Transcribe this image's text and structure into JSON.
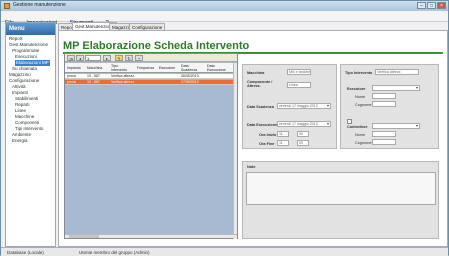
{
  "window": {
    "title": "Gestione manutenzione"
  },
  "menu": [
    "File",
    "Impostazioni",
    "Strumenti",
    "?"
  ],
  "left": {
    "header": "Menu",
    "tree": [
      {
        "label": "Report",
        "indent": 1,
        "selected": false
      },
      {
        "label": "Gest.Manutenzione",
        "indent": 1,
        "selected": false
      },
      {
        "label": "Programmate",
        "indent": 2,
        "selected": false
      },
      {
        "label": "Esecuzioni",
        "indent": 3,
        "selected": false
      },
      {
        "label": "Elaborazioni MP",
        "indent": 3,
        "selected": true
      },
      {
        "label": "Su chiamata",
        "indent": 2,
        "selected": false
      },
      {
        "label": "Magazzino",
        "indent": 1,
        "selected": false
      },
      {
        "label": "Configurazione",
        "indent": 1,
        "selected": false
      },
      {
        "label": "Attività",
        "indent": 2,
        "selected": false
      },
      {
        "label": "Impianti",
        "indent": 2,
        "selected": false
      },
      {
        "label": "Stabilimenti",
        "indent": 3,
        "selected": false
      },
      {
        "label": "Reparti",
        "indent": 3,
        "selected": false
      },
      {
        "label": "Linee",
        "indent": 3,
        "selected": false
      },
      {
        "label": "Macchine",
        "indent": 3,
        "selected": false
      },
      {
        "label": "Componenti",
        "indent": 3,
        "selected": false
      },
      {
        "label": "Tipi Intervento",
        "indent": 3,
        "selected": false
      },
      {
        "label": "Ambiente",
        "indent": 2,
        "selected": false
      },
      {
        "label": "Energia",
        "indent": 2,
        "selected": false
      }
    ]
  },
  "tabs": [
    "Report",
    "Gest.Manutenzione",
    "Magazzino",
    "Configurazione"
  ],
  "main": {
    "title": "MP Elaborazione Scheda Intervento"
  },
  "grid": {
    "page": "1",
    "columns": [
      "Impianto",
      "Macchina",
      "Tipo Intervento",
      "Frequenza",
      "Esecutore",
      "Data Scadenza",
      "Data Esecuzione"
    ],
    "rows": [
      {
        "cells": [
          "prova",
          "10 - 567",
          "Verifica attrezz.",
          "",
          "",
          "26/05/2013",
          ""
        ],
        "selected": false
      },
      {
        "cells": [
          "prova",
          "10 - 567",
          "Verifica attrezz.",
          "",
          "",
          "17/05/2013",
          ""
        ],
        "selected": true
      }
    ]
  },
  "form": {
    "macchina_label": "Macchina",
    "macchina_value": "Mix e taniche",
    "componente_label": "Componente / Attrezz.",
    "componente_value": "Linea",
    "tipo_label": "Tipo Intervento",
    "tipo_value": "Verifica attrezz.",
    "data_scad_label": "Data Scadenza",
    "data_scad_value": "venerdì 17 maggio 2013",
    "data_esec_label": "Data Esecuzione",
    "data_esec_value": "venerdì 17 maggio 2013",
    "ore_inizio_label": "Ora Inizio",
    "ore_inizio_h": "11",
    "ore_inizio_m": "00",
    "ore_fine_label": "Ora Fine",
    "ore_fine_h": "11",
    "ore_fine_m": "00",
    "esecutore_label": "Esecutore",
    "esecutore_name": "Nome",
    "esecutore_surname": "Cognome",
    "esecutore_role": "Ruolo",
    "controllore_label": "Controllore",
    "controllore_name": "Nome",
    "controllore_surname": "Cognome",
    "controllore_role": "Ruolo",
    "note_label": "Note"
  },
  "status": {
    "left": "Database (Locale)",
    "right": "Utente membro del gruppo (Admin)"
  }
}
